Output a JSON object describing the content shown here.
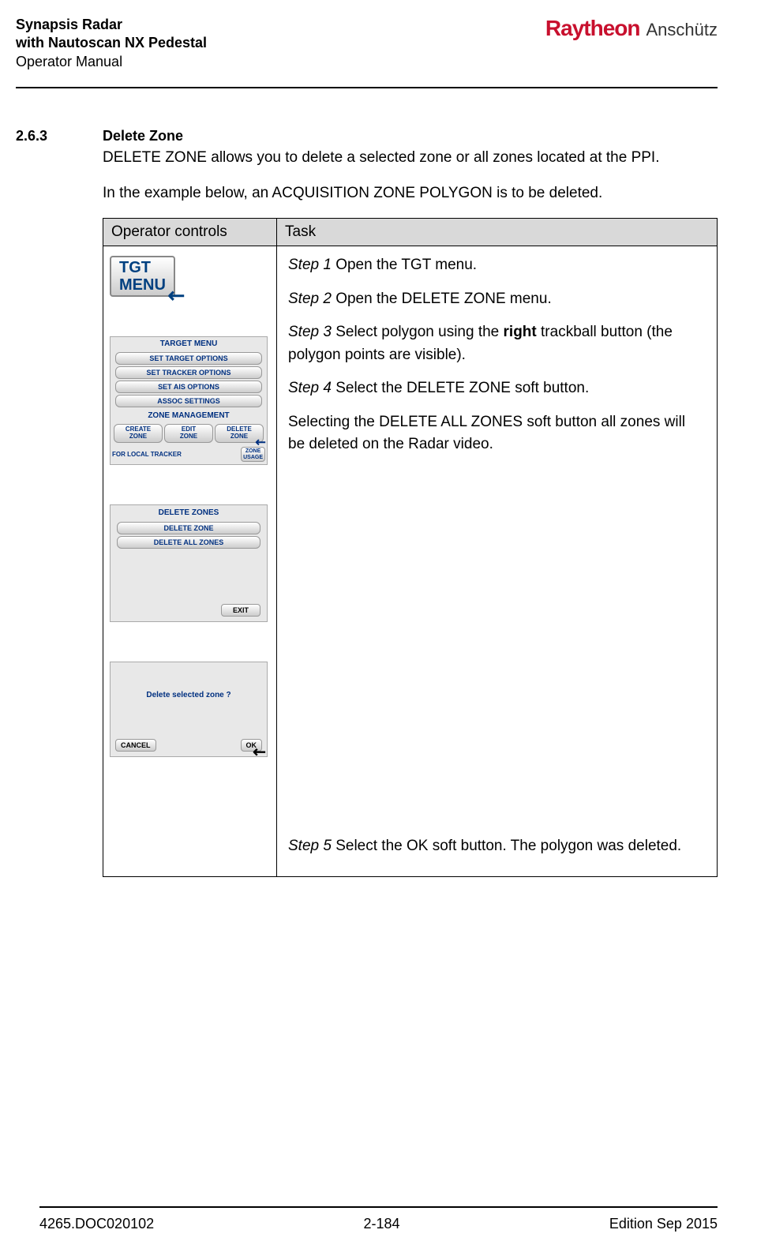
{
  "header": {
    "title_line1": "Synapsis Radar",
    "title_line2": "with Nautoscan NX Pedestal",
    "title_line3": "Operator Manual",
    "brand1": "Raytheon",
    "brand2": "Anschütz"
  },
  "section": {
    "number": "2.6.3",
    "title": "Delete Zone",
    "para1": "DELETE ZONE allows you to delete a selected zone or all zones located at the PPI.",
    "para2": "In the example below, an ACQUISITION ZONE POLYGON is to be deleted."
  },
  "table": {
    "header_ops": "Operator controls",
    "header_task": "Task",
    "steps": {
      "s1_label": "Step 1",
      "s1_text": " Open the TGT menu.",
      "s2_label": "Step 2",
      "s2_text": " Open the DELETE ZONE menu.",
      "s3_label": "Step 3",
      "s3_text_a": " Select polygon using the ",
      "s3_bold": "right",
      "s3_text_b": " trackball button (the polygon points are visible).",
      "s4_label": "Step 4",
      "s4_text": " Select the DELETE ZONE soft button.",
      "note": "Selecting the DELETE ALL ZONES soft button all zones will be deleted on the Radar video.",
      "s5_label": "Step 5",
      "s5_text": " Select the OK soft button. The polygon was deleted."
    }
  },
  "ui": {
    "tgt_menu_line1": "TGT",
    "tgt_menu_line2": "MENU",
    "target_menu_title": "TARGET MENU",
    "set_target_options": "SET TARGET OPTIONS",
    "set_tracker_options": "SET TRACKER OPTIONS",
    "set_ais_options": "SET AIS OPTIONS",
    "assoc_settings": "ASSOC SETTINGS",
    "zone_management": "ZONE MANAGEMENT",
    "create_zone_l1": "CREATE",
    "create_zone_l2": "ZONE",
    "edit_zone_l1": "EDIT",
    "edit_zone_l2": "ZONE",
    "delete_zone_l1": "DELETE",
    "delete_zone_l2": "ZONE",
    "for_local_tracker": "FOR LOCAL TRACKER",
    "zone_usage_l1": "ZONE",
    "zone_usage_l2": "USAGE",
    "delete_zones_title": "DELETE ZONES",
    "delete_zone_btn": "DELETE ZONE",
    "delete_all_zones_btn": "DELETE ALL ZONES",
    "exit_btn": "EXIT",
    "confirm_prompt": "Delete selected zone ?",
    "cancel_btn": "CANCEL",
    "ok_btn": "OK"
  },
  "footer": {
    "left": "4265.DOC020102",
    "center": "2-184",
    "right": "Edition Sep 2015"
  }
}
